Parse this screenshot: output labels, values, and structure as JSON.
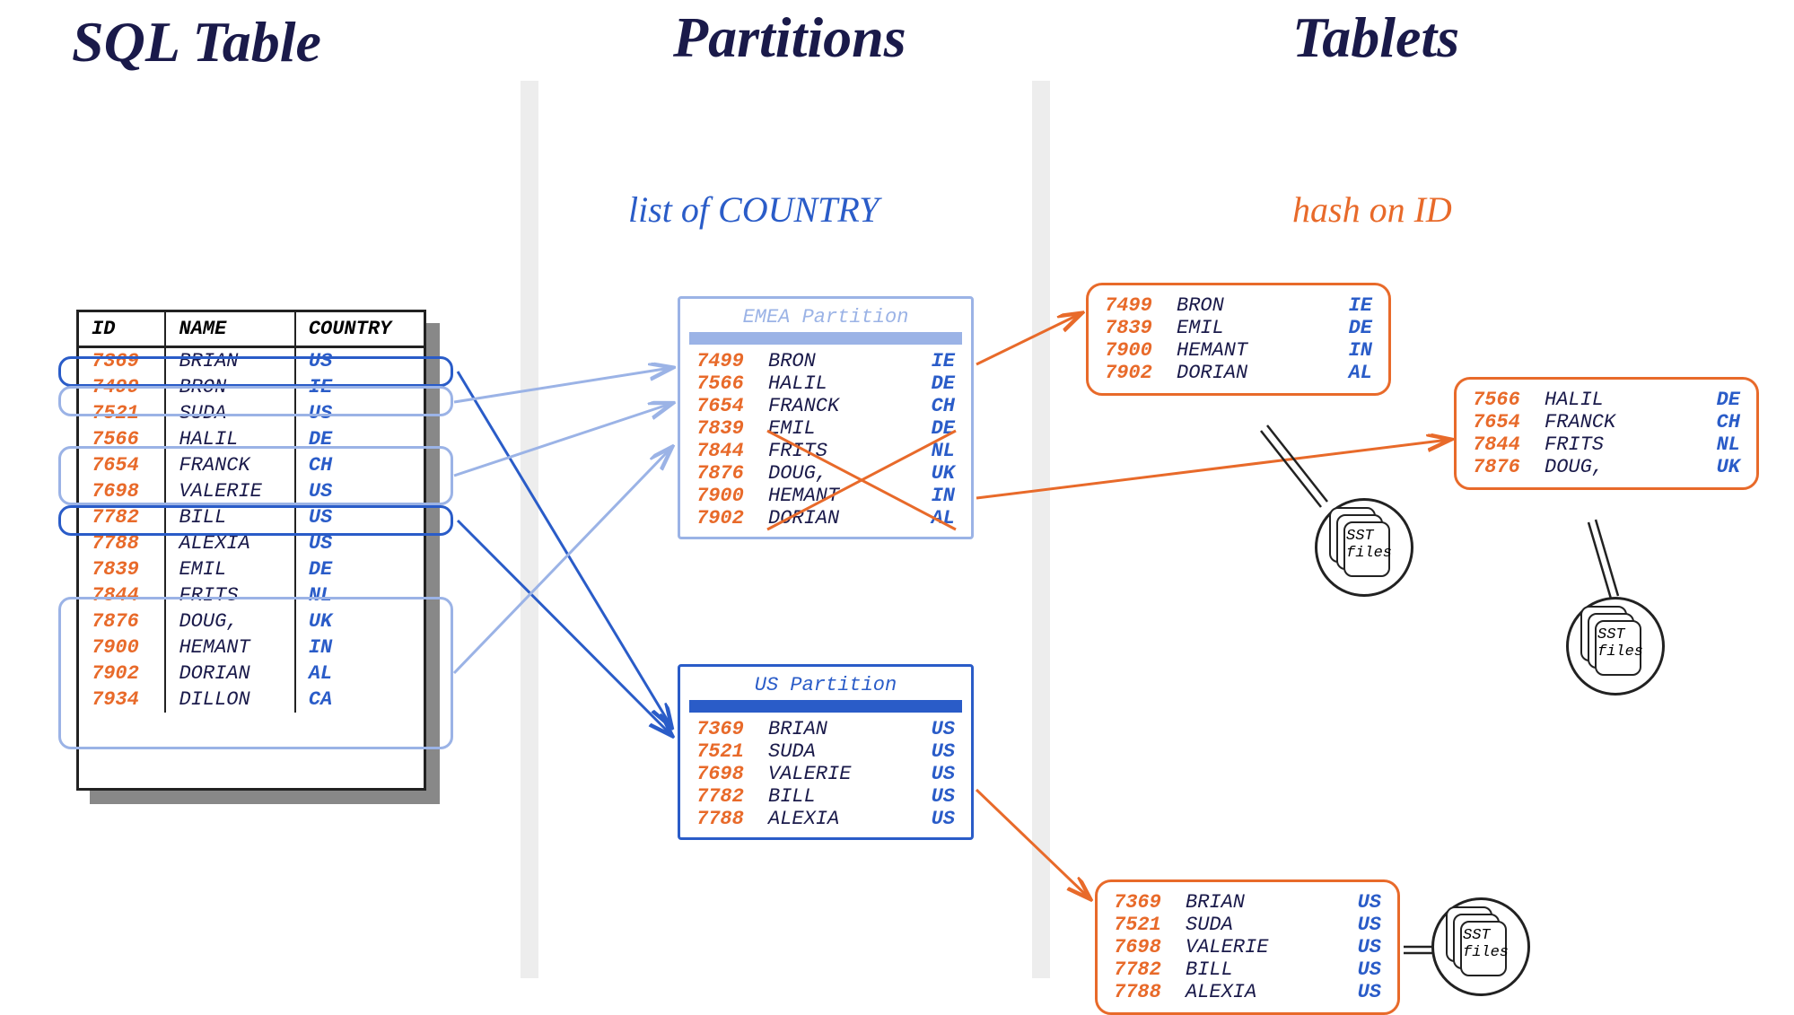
{
  "headings": {
    "sql_table": "SQL Table",
    "partitions": "Partitions",
    "tablets": "Tablets"
  },
  "subheadings": {
    "partitions": "list of COUNTRY",
    "tablets": "hash on ID"
  },
  "sql_table": {
    "columns": [
      "ID",
      "NAME",
      "COUNTRY"
    ],
    "rows": [
      {
        "id": "7369",
        "name": "BRIAN",
        "country": "US"
      },
      {
        "id": "7499",
        "name": "BRON",
        "country": "IE"
      },
      {
        "id": "7521",
        "name": "SUDA",
        "country": "US"
      },
      {
        "id": "7566",
        "name": "HALIL",
        "country": "DE"
      },
      {
        "id": "7654",
        "name": "FRANCK",
        "country": "CH"
      },
      {
        "id": "7698",
        "name": "VALERIE",
        "country": "US"
      },
      {
        "id": "7782",
        "name": "BILL",
        "country": "US"
      },
      {
        "id": "7788",
        "name": "ALEXIA",
        "country": "US"
      },
      {
        "id": "7839",
        "name": "EMIL",
        "country": "DE"
      },
      {
        "id": "7844",
        "name": "FRITS",
        "country": "NL"
      },
      {
        "id": "7876",
        "name": "DOUG,",
        "country": "UK"
      },
      {
        "id": "7900",
        "name": "HEMANT",
        "country": "IN"
      },
      {
        "id": "7902",
        "name": "DORIAN",
        "country": "AL"
      },
      {
        "id": "7934",
        "name": "DILLON",
        "country": "CA"
      }
    ]
  },
  "partitions": {
    "emea": {
      "title": "EMEA Partition",
      "rows": [
        {
          "id": "7499",
          "name": "BRON",
          "country": "IE"
        },
        {
          "id": "7566",
          "name": "HALIL",
          "country": "DE"
        },
        {
          "id": "7654",
          "name": "FRANCK",
          "country": "CH"
        },
        {
          "id": "7839",
          "name": "EMIL",
          "country": "DE"
        },
        {
          "id": "7844",
          "name": "FRITS",
          "country": "NL"
        },
        {
          "id": "7876",
          "name": "DOUG,",
          "country": "UK"
        },
        {
          "id": "7900",
          "name": "HEMANT",
          "country": "IN"
        },
        {
          "id": "7902",
          "name": "DORIAN",
          "country": "AL"
        }
      ]
    },
    "us": {
      "title": "US  Partition",
      "rows": [
        {
          "id": "7369",
          "name": "BRIAN",
          "country": "US"
        },
        {
          "id": "7521",
          "name": "SUDA",
          "country": "US"
        },
        {
          "id": "7698",
          "name": "VALERIE",
          "country": "US"
        },
        {
          "id": "7782",
          "name": "BILL",
          "country": "US"
        },
        {
          "id": "7788",
          "name": "ALEXIA",
          "country": "US"
        }
      ]
    }
  },
  "tablets": {
    "t1": {
      "rows": [
        {
          "id": "7499",
          "name": "BRON",
          "country": "IE"
        },
        {
          "id": "7839",
          "name": "EMIL",
          "country": "DE"
        },
        {
          "id": "7900",
          "name": "HEMANT",
          "country": "IN"
        },
        {
          "id": "7902",
          "name": "DORIAN",
          "country": "AL"
        }
      ]
    },
    "t2": {
      "rows": [
        {
          "id": "7566",
          "name": "HALIL",
          "country": "DE"
        },
        {
          "id": "7654",
          "name": "FRANCK",
          "country": "CH"
        },
        {
          "id": "7844",
          "name": "FRITS",
          "country": "NL"
        },
        {
          "id": "7876",
          "name": "DOUG,",
          "country": "UK"
        }
      ]
    },
    "t3": {
      "rows": [
        {
          "id": "7369",
          "name": "BRIAN",
          "country": "US"
        },
        {
          "id": "7521",
          "name": "SUDA",
          "country": "US"
        },
        {
          "id": "7698",
          "name": "VALERIE",
          "country": "US"
        },
        {
          "id": "7782",
          "name": "BILL",
          "country": "US"
        },
        {
          "id": "7788",
          "name": "ALEXIA",
          "country": "US"
        }
      ]
    }
  },
  "sst_label_line1": "SST",
  "sst_label_line2": "files"
}
